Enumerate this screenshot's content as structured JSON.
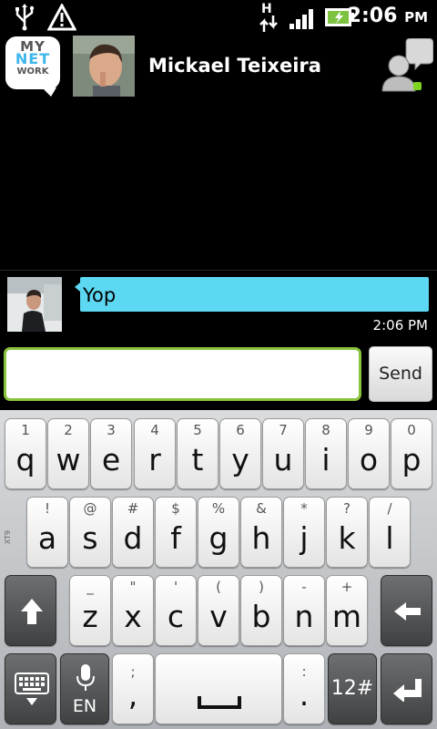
{
  "status_bar": {
    "icons": [
      "usb-icon",
      "warning-icon",
      "hspa-data-icon",
      "signal-icon",
      "battery-charging-icon"
    ],
    "network_type": "H",
    "time": "2:06",
    "ampm": "PM"
  },
  "header": {
    "app_logo": {
      "line1": "MY",
      "line2": "NET",
      "line3": "WORK"
    },
    "contact_name": "Mickael Teixeira",
    "presence_icon": "contact-status-icon",
    "presence_color": "#7ed321"
  },
  "messages": [
    {
      "text": "Yop",
      "time": "2:06 PM",
      "bubble_color": "#5cd8f2"
    }
  ],
  "compose": {
    "input_value": "",
    "input_border_color": "#8ac43f",
    "send_label": "Send"
  },
  "keyboard": {
    "side_label": "XT9",
    "row1": [
      {
        "alt": "1",
        "main": "q"
      },
      {
        "alt": "2",
        "main": "w"
      },
      {
        "alt": "3",
        "main": "e"
      },
      {
        "alt": "4",
        "main": "r"
      },
      {
        "alt": "5",
        "main": "t"
      },
      {
        "alt": "6",
        "main": "y"
      },
      {
        "alt": "7",
        "main": "u"
      },
      {
        "alt": "8",
        "main": "i"
      },
      {
        "alt": "9",
        "main": "o"
      },
      {
        "alt": "0",
        "main": "p"
      }
    ],
    "row2": [
      {
        "alt": "!",
        "main": "a"
      },
      {
        "alt": "@",
        "main": "s"
      },
      {
        "alt": "#",
        "main": "d"
      },
      {
        "alt": "$",
        "main": "f"
      },
      {
        "alt": "%",
        "main": "g"
      },
      {
        "alt": "&",
        "main": "h"
      },
      {
        "alt": "*",
        "main": "j"
      },
      {
        "alt": "?",
        "main": "k"
      },
      {
        "alt": "/",
        "main": "l"
      }
    ],
    "row3": [
      {
        "alt": "_",
        "main": "z"
      },
      {
        "alt": "\"",
        "main": "x"
      },
      {
        "alt": "'",
        "main": "c"
      },
      {
        "alt": "(",
        "main": "v"
      },
      {
        "alt": ")",
        "main": "b"
      },
      {
        "alt": "-",
        "main": "n"
      },
      {
        "alt": "+",
        "main": "m"
      }
    ],
    "row4": {
      "mic_label": "EN",
      "comma_alt": ";",
      "comma_main": ",",
      "period_alt": ":",
      "period_main": ".",
      "symbols_label": "12#"
    }
  }
}
